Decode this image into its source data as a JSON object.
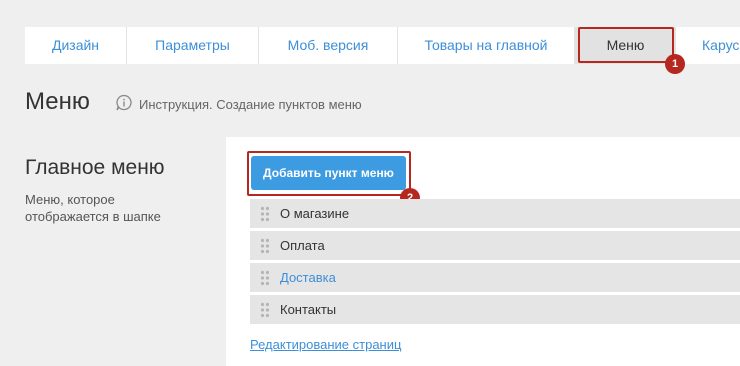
{
  "tabs": [
    {
      "label": "Дизайн"
    },
    {
      "label": "Параметры"
    },
    {
      "label": "Моб. версия"
    },
    {
      "label": "Товары на главной"
    },
    {
      "label": "Меню",
      "active": true
    },
    {
      "label": "Карус"
    }
  ],
  "annotations": {
    "badge_1": "1",
    "badge_2": "2",
    "color": "#b5271f"
  },
  "header": {
    "title": "Меню",
    "instruction": "Инструкция. Создание пунктов меню"
  },
  "section": {
    "title": "Главное меню",
    "description": "Меню, которое отображается в шапке"
  },
  "add_button": {
    "label": "Добавить пункт меню",
    "color": "#3d9be2"
  },
  "menu_items": [
    {
      "label": "О магазине"
    },
    {
      "label": "Оплата"
    },
    {
      "label": "Доставка",
      "link": true
    },
    {
      "label": "Контакты"
    }
  ],
  "edit_link": "Редактирование страниц",
  "colors": {
    "accent": "#3d8fd8",
    "background": "#efefef",
    "highlight": "#b5271f"
  }
}
